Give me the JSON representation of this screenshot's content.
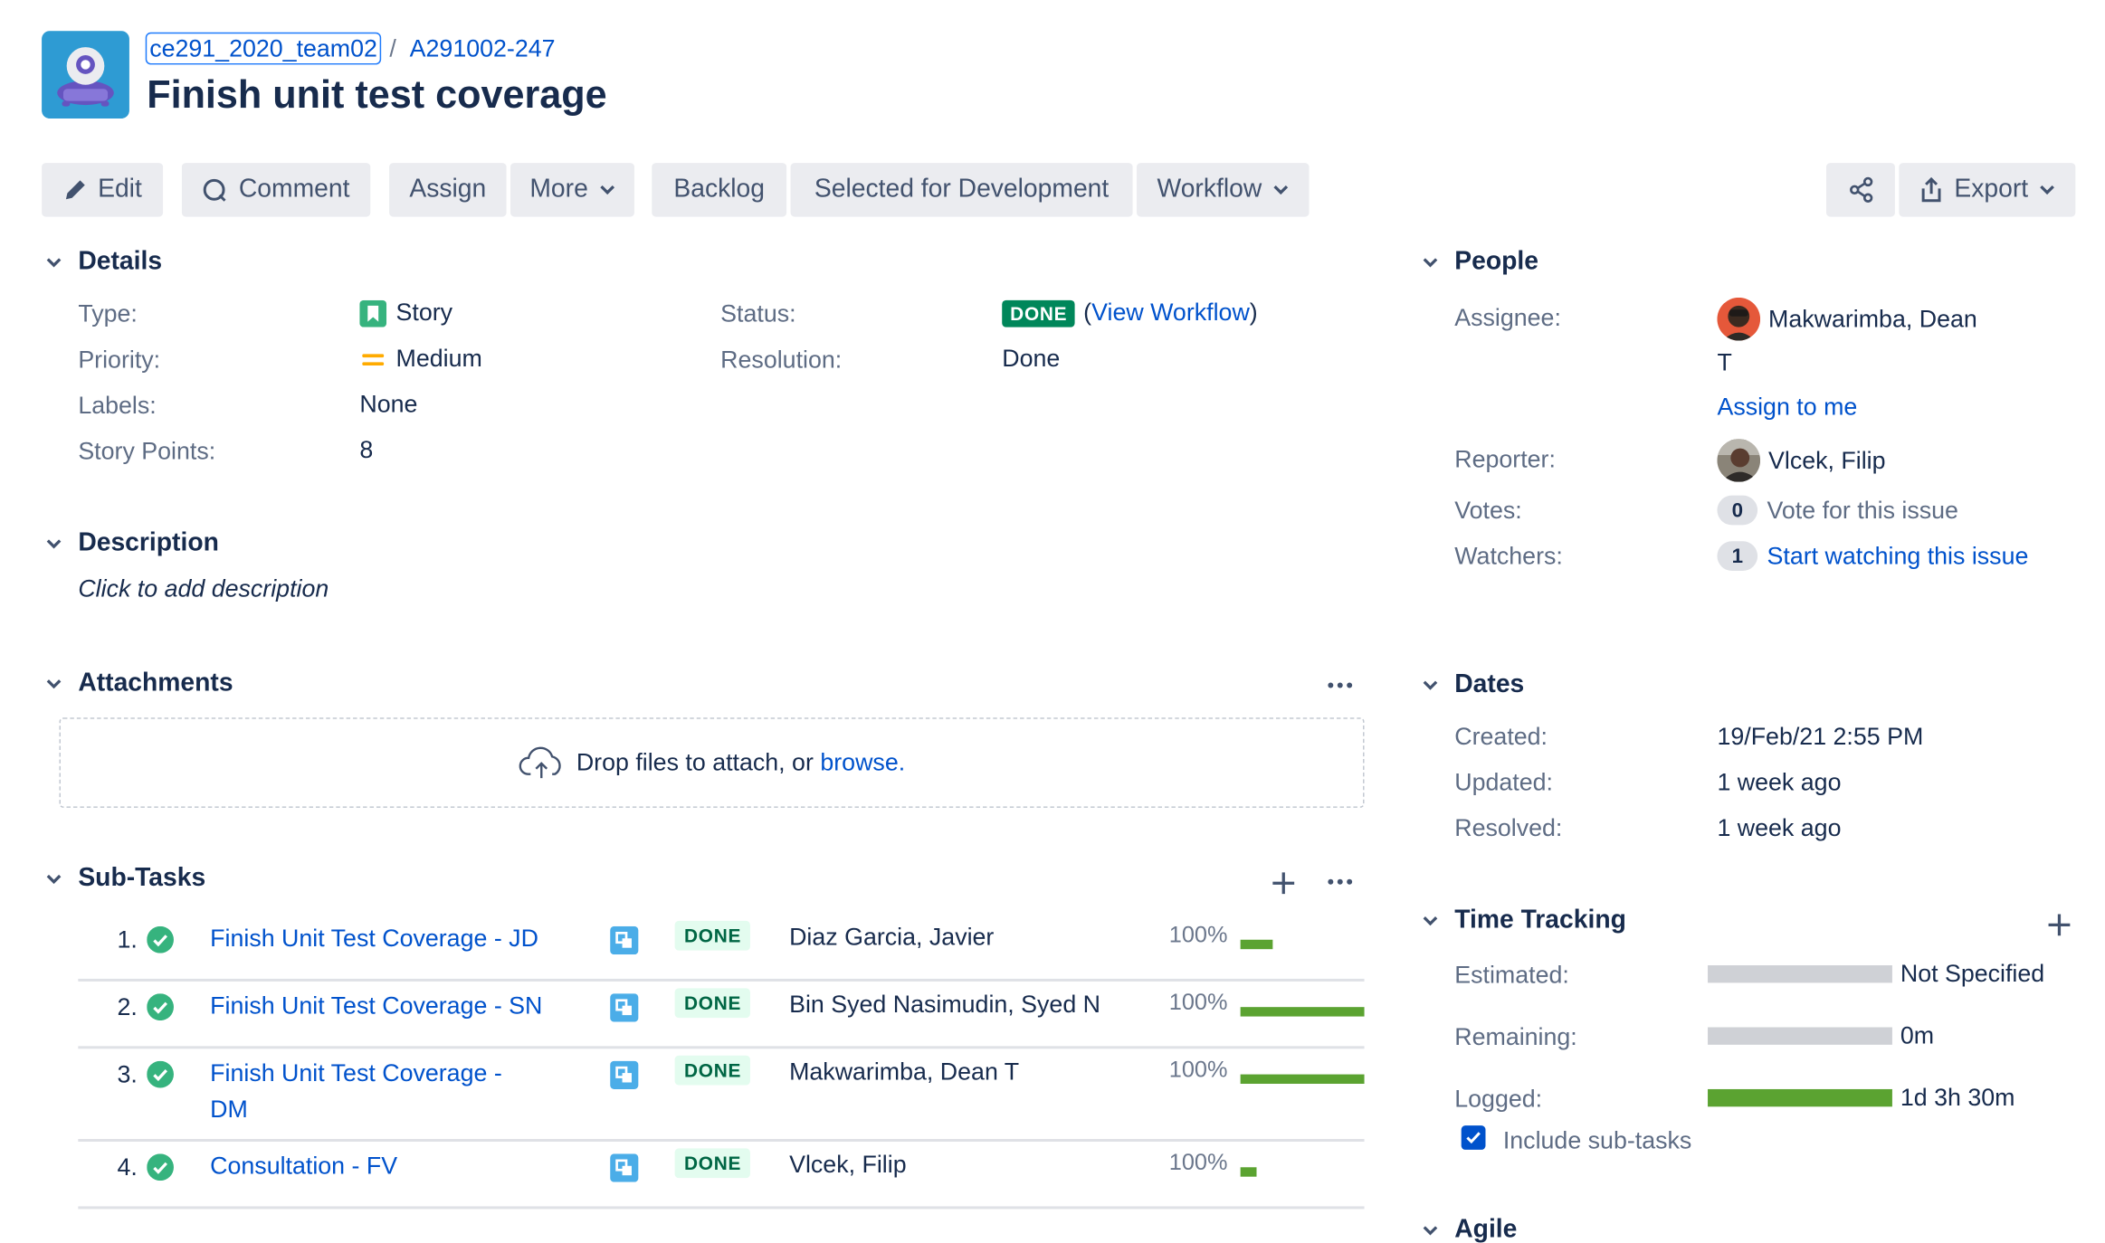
{
  "breadcrumbs": {
    "project": "ce291_2020_team02",
    "issue_key": "A291002-247"
  },
  "issue_title": "Finish unit test coverage",
  "toolbar": {
    "edit": "Edit",
    "comment": "Comment",
    "assign": "Assign",
    "more": "More",
    "backlog": "Backlog",
    "selected_for_development": "Selected for Development",
    "workflow": "Workflow",
    "export": "Export"
  },
  "details": {
    "heading": "Details",
    "type_label": "Type:",
    "type_value": "Story",
    "priority_label": "Priority:",
    "priority_value": "Medium",
    "labels_label": "Labels:",
    "labels_value": "None",
    "story_points_label": "Story Points:",
    "story_points_value": "8",
    "status_label": "Status:",
    "status_value": "DONE",
    "view_workflow": "View Workflow",
    "resolution_label": "Resolution:",
    "resolution_value": "Done"
  },
  "description": {
    "heading": "Description",
    "placeholder": "Click to add description"
  },
  "attachments": {
    "heading": "Attachments",
    "drop_text": "Drop files to attach, or",
    "browse": "browse."
  },
  "subtasks": {
    "heading": "Sub-Tasks",
    "items": [
      {
        "num": "1.",
        "summary_lines": [
          "Finish Unit Test Coverage - JD"
        ],
        "status": "DONE",
        "assignee": "Diaz Garcia, Javier",
        "percent": "100%",
        "progress": 1.0,
        "logged_share": 0.26
      },
      {
        "num": "2.",
        "summary_lines": [
          "Finish Unit Test Coverage - SN"
        ],
        "status": "DONE",
        "assignee": "Bin Syed Nasimudin, Syed N",
        "percent": "100%",
        "progress": 1.0,
        "logged_share": 1.0
      },
      {
        "num": "3.",
        "summary_lines": [
          "Finish Unit Test Coverage -",
          "DM"
        ],
        "status": "DONE",
        "assignee": "Makwarimba, Dean T",
        "percent": "100%",
        "progress": 1.0,
        "logged_share": 1.0
      },
      {
        "num": "4.",
        "summary_lines": [
          "Consultation - FV"
        ],
        "status": "DONE",
        "assignee": "Vlcek, Filip",
        "percent": "100%",
        "progress": 1.0,
        "logged_share": 0.13
      }
    ]
  },
  "people": {
    "heading": "People",
    "assignee_label": "Assignee:",
    "assignee_line1": "Makwarimba, Dean",
    "assignee_line2": "T",
    "assign_to_me": "Assign to me",
    "reporter_label": "Reporter:",
    "reporter_value": "Vlcek, Filip",
    "votes_label": "Votes:",
    "votes_count": "0",
    "vote_text": "Vote for this issue",
    "watchers_label": "Watchers:",
    "watchers_count": "1",
    "watch_text": "Start watching this issue"
  },
  "dates": {
    "heading": "Dates",
    "created_label": "Created:",
    "created_value": "19/Feb/21 2:55 PM",
    "updated_label": "Updated:",
    "updated_value": "1 week ago",
    "resolved_label": "Resolved:",
    "resolved_value": "1 week ago"
  },
  "time_tracking": {
    "heading": "Time Tracking",
    "estimated_label": "Estimated:",
    "estimated_value": "Not Specified",
    "remaining_label": "Remaining:",
    "remaining_value": "0m",
    "logged_label": "Logged:",
    "logged_value": "1d 3h 30m",
    "include_subtasks": "Include sub-tasks"
  },
  "agile": {
    "heading": "Agile"
  },
  "colors": {
    "link": "#0052cc",
    "done": "#00875a",
    "progress": "#5ba331",
    "button_bg": "#ebecf0"
  }
}
